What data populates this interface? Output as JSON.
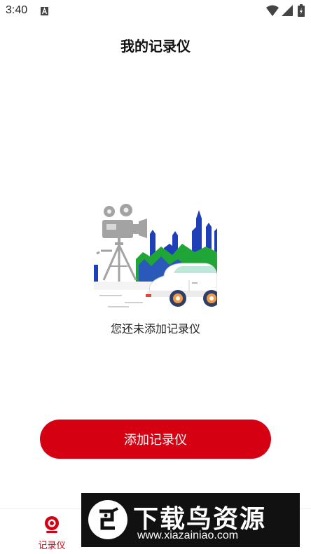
{
  "status_bar": {
    "time": "3:40"
  },
  "header": {
    "title": "我的记录仪"
  },
  "empty_state": {
    "message": "您还未添加记录仪"
  },
  "actions": {
    "add_button_label": "添加记录仪"
  },
  "bottom_nav": {
    "items": [
      {
        "label": "记录仪",
        "icon": "camera-icon",
        "active": true
      }
    ]
  },
  "overlay": {
    "brand_text": "下载鸟资源",
    "url": "www.xiazainiao.com"
  },
  "colors": {
    "accent": "#d50012",
    "background": "#ffffff"
  }
}
